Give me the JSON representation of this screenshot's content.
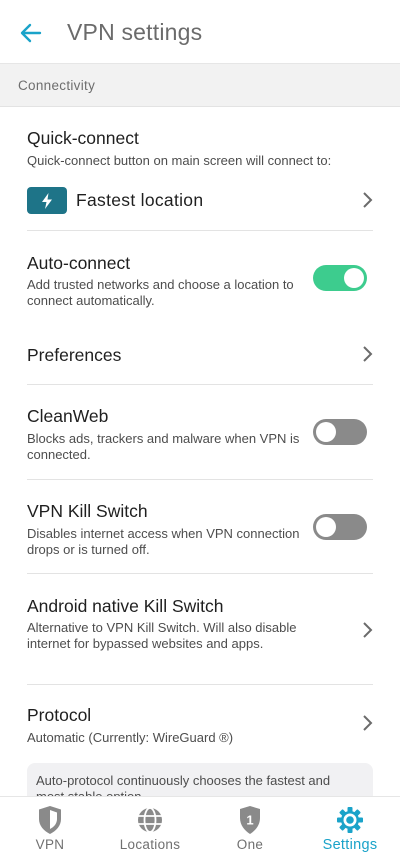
{
  "header": {
    "title": "VPN settings"
  },
  "section": {
    "title": "Connectivity"
  },
  "quick_connect": {
    "label": "Quick-connect",
    "desc": "Quick-connect button on main screen will connect to:",
    "location": "Fastest location"
  },
  "auto_connect": {
    "label": "Auto-connect",
    "desc": "Add trusted networks and choose a location to connect automatically.",
    "enabled": true
  },
  "preferences": {
    "label": "Preferences"
  },
  "cleanweb": {
    "label": "CleanWeb",
    "desc": "Blocks ads, trackers and malware when VPN is connected.",
    "enabled": false
  },
  "kill_switch": {
    "label": "VPN Kill Switch",
    "desc": "Disables internet access when VPN connection drops or is turned off.",
    "enabled": false
  },
  "android_kill_switch": {
    "label": "Android native Kill Switch",
    "desc": "Alternative to VPN Kill Switch. Will also disable internet for bypassed websites and apps."
  },
  "protocol": {
    "label": "Protocol",
    "desc": "Automatic (Currently: WireGuard ®)",
    "info": "Auto-protocol continuously chooses the fastest and most stable option."
  },
  "bottom_nav": {
    "items": [
      {
        "label": "VPN",
        "icon": "shield-icon"
      },
      {
        "label": "Locations",
        "icon": "globe-icon"
      },
      {
        "label": "One",
        "icon": "one-badge-icon",
        "badge": "1"
      },
      {
        "label": "Settings",
        "icon": "gear-icon",
        "active": true
      }
    ]
  },
  "colors": {
    "accent": "#1aa3c9",
    "toggle_on": "#3dcc8e",
    "toggle_off": "#8a8a8a",
    "bolt_bg": "#1e7488"
  }
}
